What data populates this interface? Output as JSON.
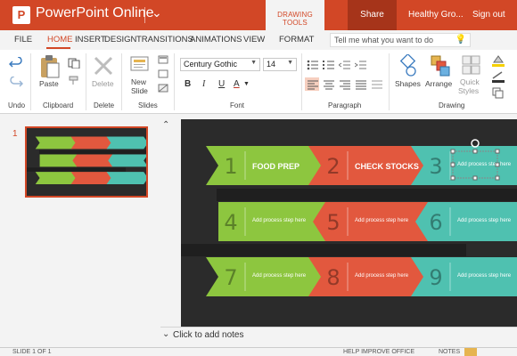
{
  "titlebar": {
    "logo": "P",
    "app_title": "PowerPoint Online",
    "context_tab": "DRAWING TOOLS",
    "share": "Share",
    "user": "Healthy Gro...",
    "sign_out": "Sign out",
    "bg_color": "#d24726"
  },
  "tabs": {
    "file": "FILE",
    "home": "HOME",
    "insert": "INSERT",
    "design": "DESIGN",
    "transitions": "TRANSITIONS",
    "animations": "ANIMATIONS",
    "view": "VIEW",
    "format": "FORMAT",
    "tell_me": "Tell me what you want to do",
    "active": "HOME"
  },
  "ribbon": {
    "undo": "Undo",
    "paste": "Paste",
    "clipboard": "Clipboard",
    "delete": "Delete",
    "delete_group": "Delete",
    "new_slide_1": "New",
    "new_slide_2": "Slide",
    "slides": "Slides",
    "font_name": "Century Gothic",
    "font_size": "14",
    "font_group": "Font",
    "bold": "B",
    "italic": "I",
    "underline": "U",
    "font_color": "A",
    "paragraph": "Paragraph",
    "shapes": "Shapes",
    "arrange": "Arrange",
    "quick_styles_1": "Quick",
    "quick_styles_2": "Styles",
    "drawing": "Drawing"
  },
  "thumbnails": {
    "slide_number": "1"
  },
  "slide": {
    "background": "#2b2b2b",
    "rows": [
      {
        "steps": [
          {
            "num": "1",
            "label": "FOOD PREP",
            "color": "#8dc63f"
          },
          {
            "num": "2",
            "label": "CHECK STOCKS",
            "color": "#e2583e"
          },
          {
            "num": "3",
            "label": "Add process step here",
            "color": "#4fc1b0"
          }
        ]
      },
      {
        "steps": [
          {
            "num": "6",
            "label": "Add process step here",
            "color": "#4fc1b0"
          },
          {
            "num": "5",
            "label": "Add process step here",
            "color": "#e2583e"
          },
          {
            "num": "4",
            "label": "Add process step here",
            "color": "#8dc63f"
          }
        ]
      },
      {
        "steps": [
          {
            "num": "7",
            "label": "Add process step here",
            "color": "#8dc63f"
          },
          {
            "num": "8",
            "label": "Add process step here",
            "color": "#e2583e"
          },
          {
            "num": "9",
            "label": "Add process step here",
            "color": "#4fc1b0"
          }
        ]
      }
    ]
  },
  "notes": {
    "placeholder": "Click to add notes"
  },
  "statusbar": {
    "slide_info": "SLIDE 1 OF 1",
    "help": "HELP IMPROVE OFFICE",
    "notes": "NOTES"
  }
}
